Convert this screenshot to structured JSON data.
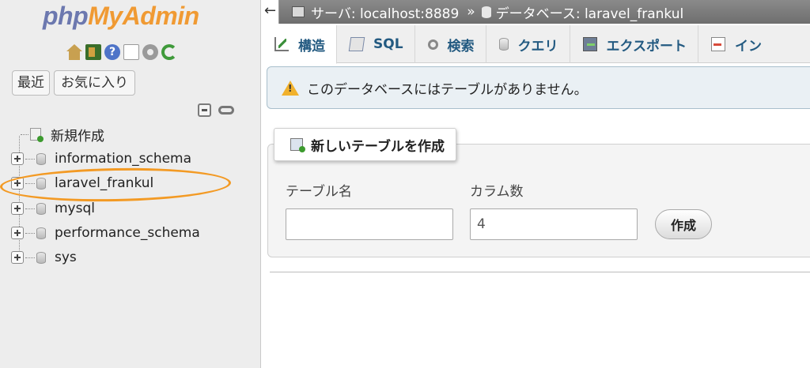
{
  "sidebar": {
    "logo": {
      "part1": "php",
      "part2": "MyAdmin"
    },
    "buttons": {
      "recent": "最近",
      "favorites": "お気に入り"
    },
    "tree": {
      "new_label": "新規作成",
      "databases": [
        "information_schema",
        "laravel_frankul",
        "mysql",
        "performance_schema",
        "sys"
      ]
    },
    "highlight_color": "#f39a24"
  },
  "topbar": {
    "back": "←",
    "server": "サーバ: localhost:8889",
    "separator": "»",
    "database": "データベース: laravel_frankul"
  },
  "tabs": [
    {
      "label": "構造",
      "icon": "structure-icon",
      "active": true
    },
    {
      "label": "SQL",
      "icon": "sql-icon",
      "active": false
    },
    {
      "label": "検索",
      "icon": "search-icon",
      "active": false
    },
    {
      "label": "クエリ",
      "icon": "query-icon",
      "active": false
    },
    {
      "label": "エクスポート",
      "icon": "export-icon",
      "active": false
    },
    {
      "label": "イン",
      "icon": "import-icon",
      "active": false
    }
  ],
  "notice": {
    "text": "このデータベースにはテーブルがありません。",
    "icon": "warning-icon"
  },
  "create_table": {
    "legend": "新しいテーブルを作成",
    "name_label": "テーブル名",
    "name_value": "",
    "columns_label": "カラム数",
    "columns_value": "4",
    "submit": "作成"
  }
}
